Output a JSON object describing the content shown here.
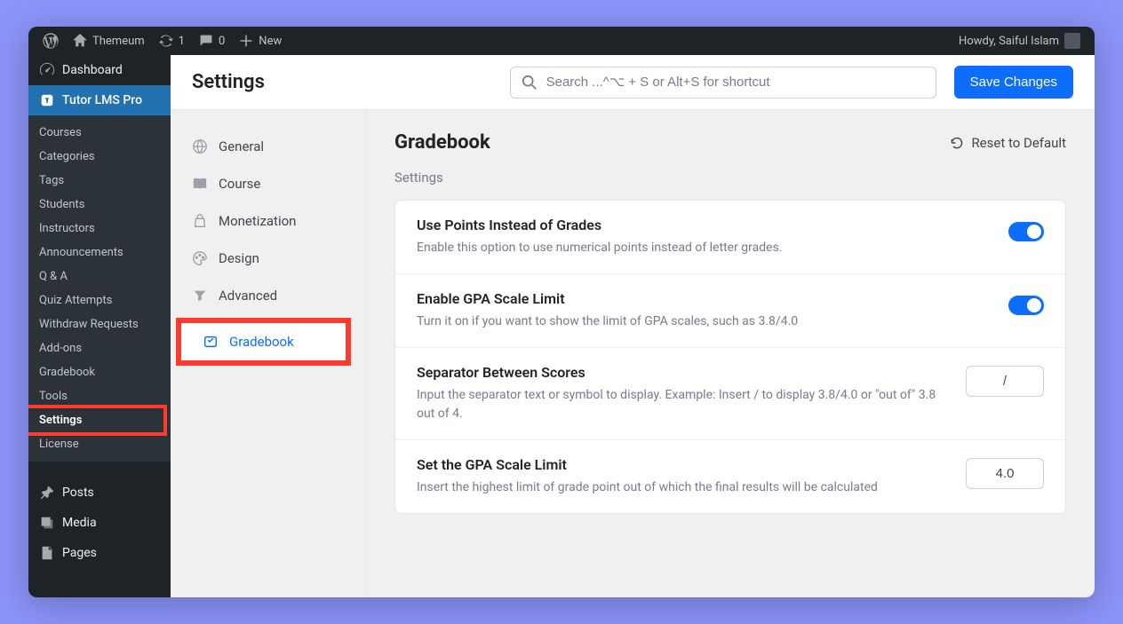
{
  "admin_bar": {
    "site_name": "Themeum",
    "updates": "1",
    "comments": "0",
    "new_label": "New",
    "howdy": "Howdy, Saiful Islam"
  },
  "wp_sidebar": {
    "dashboard": "Dashboard",
    "tutor": "Tutor LMS Pro",
    "submenu": [
      "Courses",
      "Categories",
      "Tags",
      "Students",
      "Instructors",
      "Announcements",
      "Q & A",
      "Quiz Attempts",
      "Withdraw Requests",
      "Add-ons",
      "Gradebook",
      "Tools",
      "Settings",
      "License"
    ],
    "posts": "Posts",
    "media": "Media",
    "pages": "Pages"
  },
  "topbar": {
    "title": "Settings",
    "search_placeholder": "Search ...^⌥ + S or Alt+S for shortcut",
    "save_label": "Save Changes"
  },
  "settings_nav": [
    {
      "label": "General",
      "icon": "globe"
    },
    {
      "label": "Course",
      "icon": "book"
    },
    {
      "label": "Monetization",
      "icon": "bag"
    },
    {
      "label": "Design",
      "icon": "palette"
    },
    {
      "label": "Advanced",
      "icon": "filter"
    },
    {
      "label": "Gradebook",
      "icon": "gradebook",
      "active": true
    }
  ],
  "main": {
    "heading": "Gradebook",
    "reset_label": "Reset to Default",
    "subheading": "Settings",
    "fields": {
      "use_points": {
        "title": "Use Points Instead of Grades",
        "desc": "Enable this option to use numerical points instead of letter grades."
      },
      "enable_gpa": {
        "title": "Enable GPA Scale Limit",
        "desc": "Turn it on if you want to show the limit of GPA scales, such as 3.8/4.0"
      },
      "separator": {
        "title": "Separator Between Scores",
        "desc": "Input the separator text or symbol to display. Example: Insert / to display 3.8/4.0 or \"out of\" 3.8 out of 4.",
        "value": "/"
      },
      "scale_limit": {
        "title": "Set the GPA Scale Limit",
        "desc": "Insert the highest limit of grade point out of which the final results will be calculated",
        "value": "4.0"
      }
    }
  }
}
